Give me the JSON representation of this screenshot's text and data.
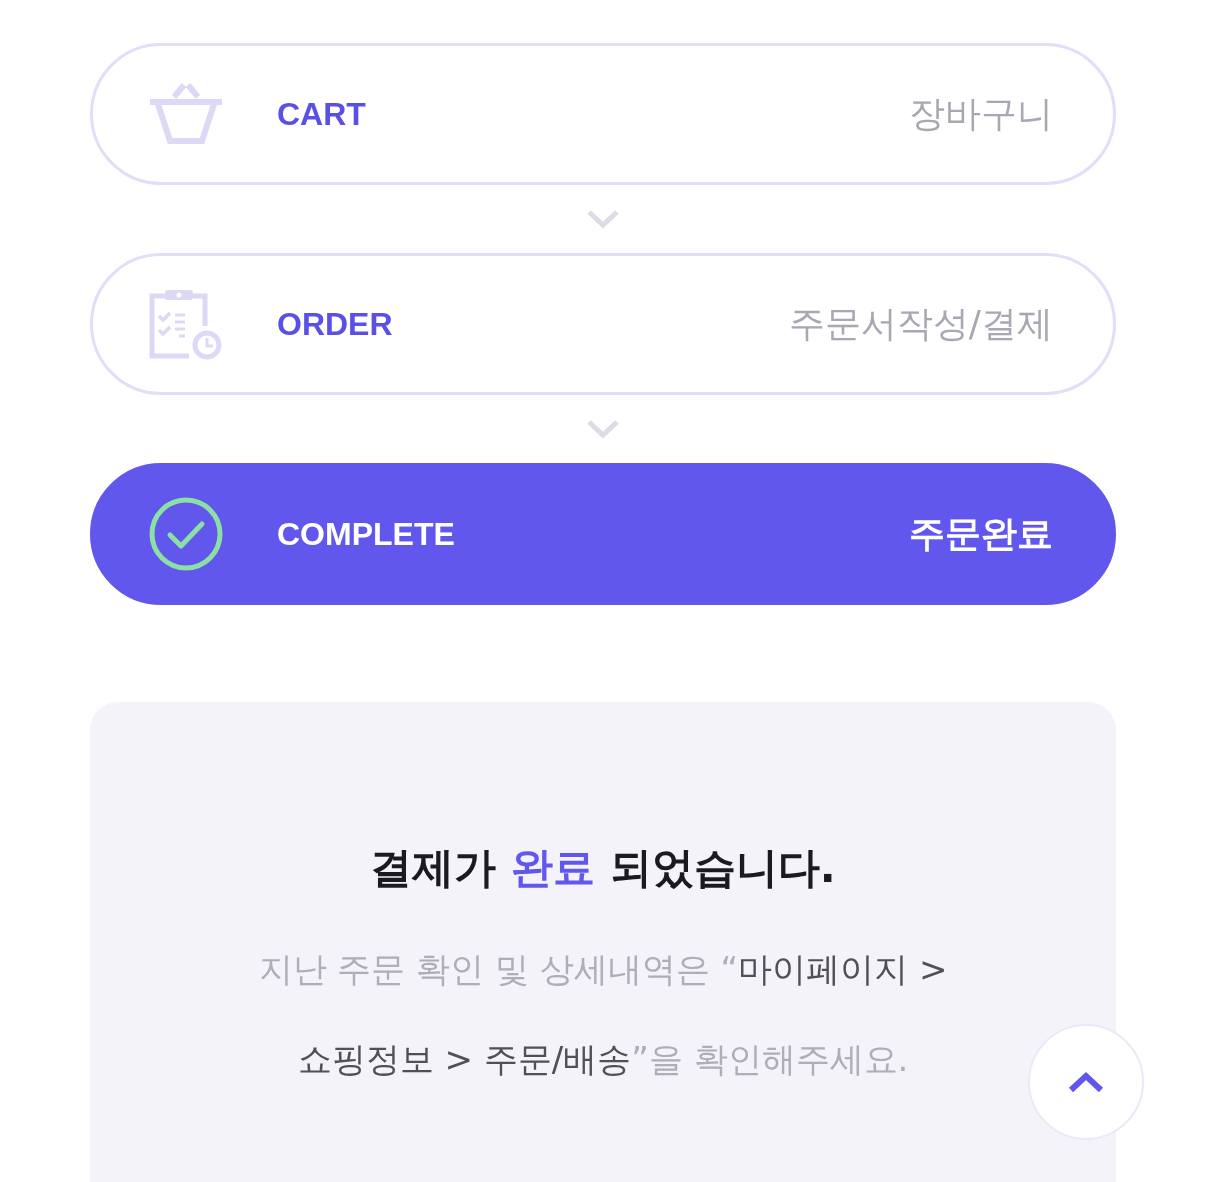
{
  "steps": [
    {
      "kind": "cart",
      "label": "CART",
      "caption": "장바구니",
      "selected": false
    },
    {
      "kind": "order",
      "label": "ORDER",
      "caption": "주문서작성/결제",
      "selected": false
    },
    {
      "kind": "complete",
      "label": "COMPLETE",
      "caption": "주문완료",
      "selected": true
    }
  ],
  "message": {
    "title": [
      {
        "text": "결제가 ",
        "highlight": false
      },
      {
        "text": "완료",
        "highlight": true
      },
      {
        "text": " 되었습니다.",
        "highlight": false
      }
    ],
    "description": [
      {
        "text": "지난 주문 확인 및 상세내역은 “",
        "highlight": false
      },
      {
        "text": "마이페이지 > 쇼핑정보 > 주문/배송",
        "highlight": true
      },
      {
        "text": "”을 확인해주세요.",
        "highlight": false
      }
    ]
  }
}
